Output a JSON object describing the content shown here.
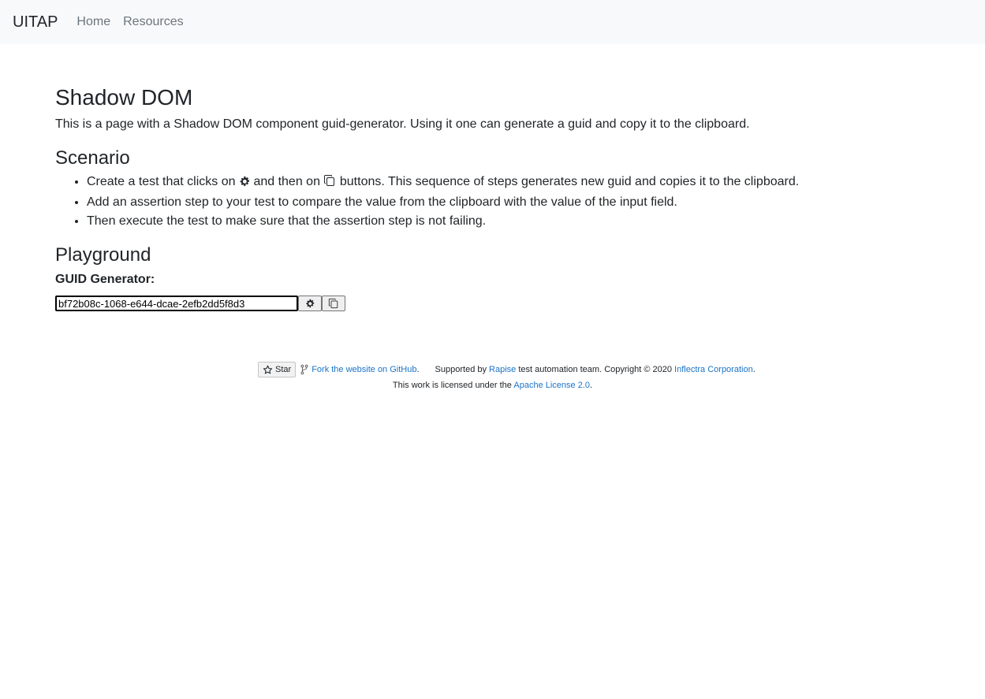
{
  "navbar": {
    "brand": "UITAP",
    "links": [
      "Home",
      "Resources"
    ]
  },
  "page": {
    "title": "Shadow DOM",
    "intro": "This is a page with a Shadow DOM component guid-generator. Using it one can generate a guid and copy it to the clipboard.",
    "scenario_heading": "Scenario",
    "scenario_item1_before": "Create a test that clicks on",
    "scenario_item1_middle": "and then on",
    "scenario_item1_after": "buttons. This sequence of steps generates new guid and copies it to the clipboard.",
    "scenario_item2": "Add an assertion step to your test to compare the value from the clipboard with the value of the input field.",
    "scenario_item3": "Then execute the test to make sure that the assertion step is not failing.",
    "playground_heading": "Playground",
    "guid_label": "GUID Generator:",
    "guid_value": "bf72b08c-1068-e644-dcae-2efb2dd5f8d3"
  },
  "footer": {
    "star_label": "Star",
    "fork_link": "Fork the website on GitHub",
    "supported_prefix": "Supported by",
    "rapise_link": "Rapise",
    "supported_middle": "test automation team. Copyright © 2020",
    "inflectra_link": "Inflectra Corporation",
    "license_prefix": "This work is licensed under the",
    "license_link": "Apache License 2.0"
  },
  "icons": {
    "generate": "gear-icon",
    "copy": "copy-icon",
    "star": "star-icon",
    "fork": "fork-icon"
  }
}
